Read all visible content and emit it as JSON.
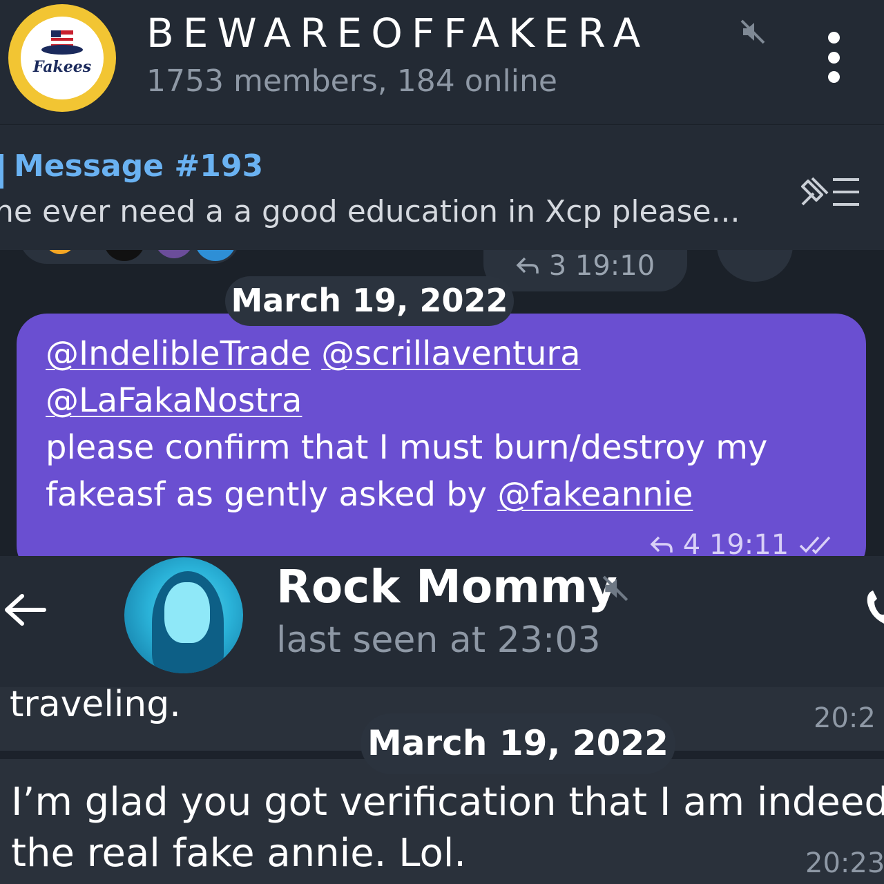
{
  "top_screenshot": {
    "group": {
      "avatar_text": "Fakees",
      "title": "BEWAREOFFAKERA",
      "subtitle": "1753 members, 184 online",
      "muted_icon": "muted-speaker-icon",
      "menu_icon": "more-vert-icon"
    },
    "pinned": {
      "title": "Message #193",
      "preview": "ne ever need a a good education in Xcp please..."
    },
    "previous_message": {
      "replies": "3",
      "time": "19:10"
    },
    "date_separator": "March 19, 2022",
    "outgoing_message": {
      "mentions_line1": [
        "@IndelibleTrade",
        "@scrillaventura"
      ],
      "mention_line2": "@LaFakaNostra",
      "body_line1": "please confirm that I must burn/destroy my",
      "body_line2_prefix": "fakeasf as gently asked by ",
      "body_line2_mention": "@fakeannie",
      "replies": "4",
      "time": "19:11",
      "status_icon": "double-check-icon"
    },
    "colors": {
      "accent": "#6ab2f2",
      "outgoing_bubble": "#6a4fd1",
      "header_bg": "#232a34"
    }
  },
  "bottom_screenshot": {
    "contact": {
      "name": "Rock Mommy",
      "status": "last seen at 23:03"
    },
    "messages": [
      {
        "text": "traveling.",
        "time": "20:2"
      },
      {
        "date_separator": "March 19, 2022"
      },
      {
        "line1": "I’m glad you got verification that I am indeed",
        "line2": "the real fake annie. Lol.",
        "time": "20:23"
      }
    ]
  }
}
